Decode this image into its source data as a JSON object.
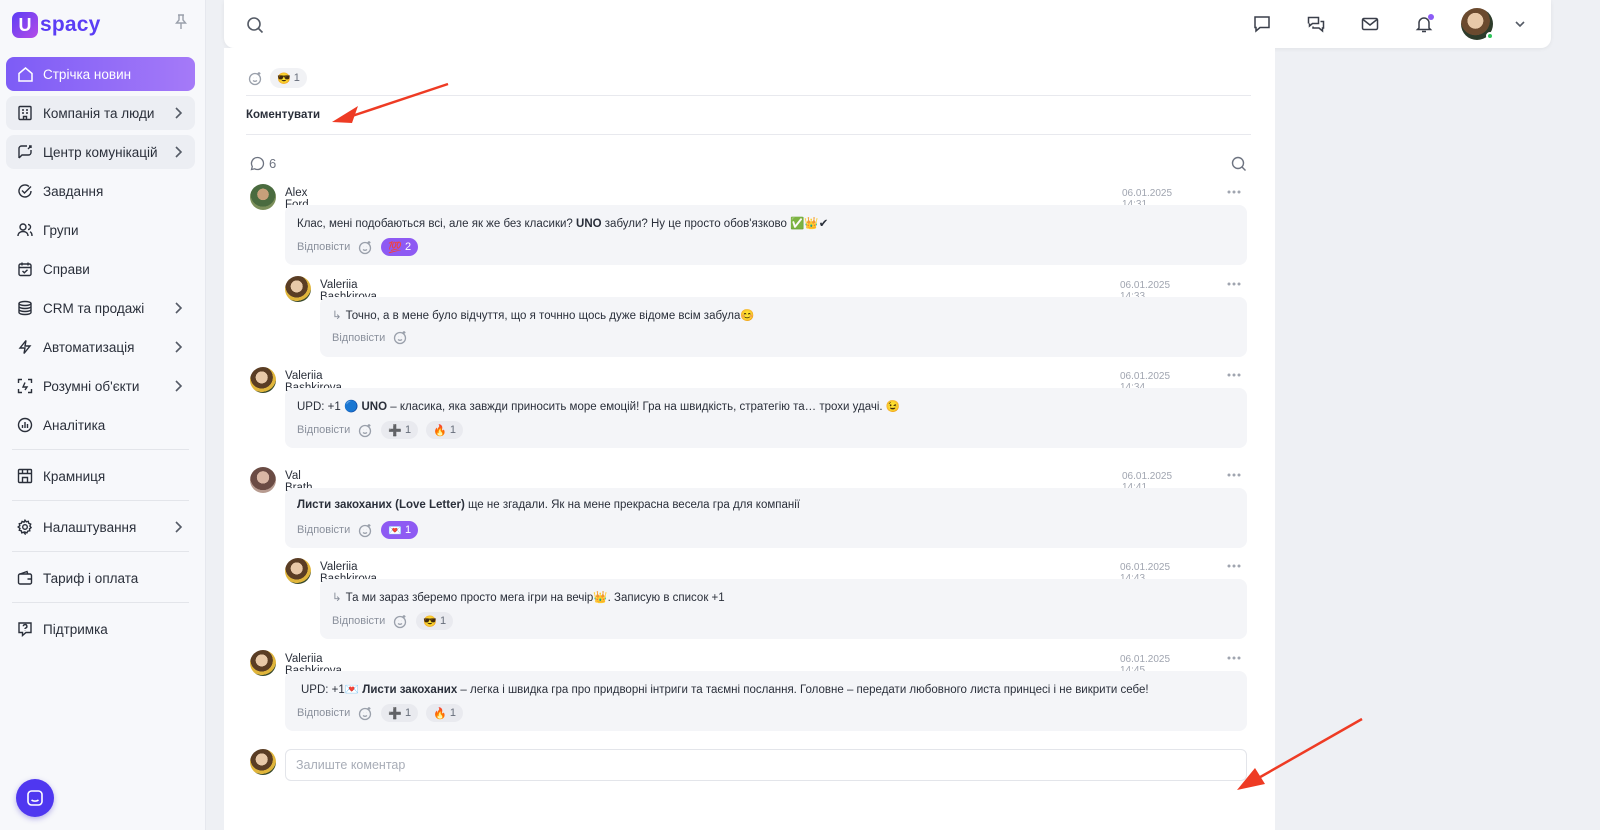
{
  "app": {
    "logo_mark": "U",
    "logo_text": "spacy"
  },
  "sidebar": {
    "items": [
      {
        "label": "Стрічка новин",
        "icon": "home-icon",
        "active": true,
        "chevron": false
      },
      {
        "label": "Компанія та люди",
        "icon": "building-icon",
        "chevron": true
      },
      {
        "label": "Центр комунікацій",
        "icon": "communication-icon",
        "chevron": true
      },
      {
        "label": "Завдання",
        "icon": "check-circle-icon",
        "chevron": false
      },
      {
        "label": "Групи",
        "icon": "users-icon",
        "chevron": false
      },
      {
        "label": "Справи",
        "icon": "calendar-icon",
        "chevron": false
      },
      {
        "label": "CRM та продажі",
        "icon": "coins-icon",
        "chevron": true
      },
      {
        "label": "Автоматизація",
        "icon": "lightning-icon",
        "chevron": true
      },
      {
        "label": "Розумні об'єкти",
        "icon": "smart-object-icon",
        "chevron": true
      },
      {
        "label": "Аналітика",
        "icon": "analytics-icon",
        "chevron": false
      },
      {
        "label": "Крамниця",
        "icon": "store-icon",
        "chevron": false
      },
      {
        "label": "Налаштування",
        "icon": "gear-icon",
        "chevron": true
      },
      {
        "label": "Тариф і оплата",
        "icon": "wallet-icon",
        "chevron": false
      },
      {
        "label": "Підтримка",
        "icon": "support-icon",
        "chevron": false
      }
    ]
  },
  "post": {
    "reaction_emoji": "😎",
    "reaction_count": "1",
    "comment_action": "Коментувати",
    "comments_count": "6"
  },
  "comments": [
    {
      "author": "Alex Ford",
      "time": "06.01.2025 14:31",
      "text_before": "Клас, мені подобаються всі, але як же без класики? ",
      "text_bold": "UNO",
      "text_after": " забули? Ну це просто обов'язково ✅👑✔",
      "reply_label": "Відповісти",
      "reactions": [
        {
          "emoji": "💯",
          "count": "2",
          "own": true
        }
      ]
    },
    {
      "author": "Valeriia Bashkirova",
      "time": "06.01.2025 14:33",
      "text_before": "Точно, а в мене було відчуття, що я точнно щось дуже відоме всім забула😊",
      "text_bold": "",
      "text_after": "",
      "reply_label": "Відповісти",
      "reactions": []
    },
    {
      "author": "Valeriia Bashkirova",
      "time": "06.01.2025 14:34",
      "text_before": "UPD: +1 🔵 ",
      "text_bold": "UNO",
      "text_after": "  – класика, яка завжди приносить море емоцій! Гра на швидкість, стратегію та… трохи удачі. 😉",
      "reply_label": "Відповісти",
      "reactions": [
        {
          "emoji": "➕",
          "count": "1",
          "own": false
        },
        {
          "emoji": "🔥",
          "count": "1",
          "own": false
        }
      ]
    },
    {
      "author": "Val Brath",
      "time": "06.01.2025 14:41",
      "text_before": "",
      "text_bold": "Листи закоханих (Love Letter)",
      "text_after": " ще не згадали. Як на мене прекрасна весела гра для компанії",
      "reply_label": "Відповісти",
      "reactions": [
        {
          "emoji": "💌",
          "count": "1",
          "own": true
        }
      ]
    },
    {
      "author": "Valeriia Bashkirova",
      "time": "06.01.2025 14:43",
      "text_before": "Та ми зараз зберемо просто мега ігри на вечір👑. Записую в список +1",
      "text_bold": "",
      "text_after": "",
      "reply_label": "Відповісти",
      "reactions": [
        {
          "emoji": "😎",
          "count": "1",
          "own": false
        }
      ]
    },
    {
      "author": "Valeriia Bashkirova",
      "time": "06.01.2025 14:45",
      "text_before": "UPD: +1💌 ",
      "text_bold": "Листи закоханих",
      "text_after": " – легка і швидка гра про придворні інтриги та таємні послання. Головне – передати любовного листа принцесі і не викрити себе!",
      "reply_label": "Відповісти",
      "reactions": [
        {
          "emoji": "➕",
          "count": "1",
          "own": false
        },
        {
          "emoji": "🔥",
          "count": "1",
          "own": false
        }
      ]
    }
  ],
  "comment_input": {
    "placeholder": "Залиште коментар",
    "value": ""
  },
  "colors": {
    "accent": "#8e5af3",
    "brand": "#5b3df5",
    "annotation_arrow": "#ee3b24"
  }
}
